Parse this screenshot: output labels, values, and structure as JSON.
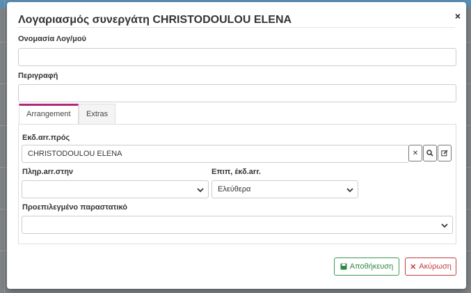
{
  "modal": {
    "title": "Λογαριασμός συνεργάτη CHRISTODOULOU ELENA",
    "close_symbol": "×"
  },
  "fields": {
    "account_name": {
      "label": "Ονομασία Λογ/μού",
      "value": ""
    },
    "description": {
      "label": "Περιγραφή",
      "value": ""
    }
  },
  "tabs": [
    {
      "label": "Arrangement",
      "active": true
    },
    {
      "label": "Extras",
      "active": false
    }
  ],
  "arrangement": {
    "issued_to": {
      "label": "Εκδ.αrr.πρός",
      "value": "CHRISTODOULOU ELENA"
    },
    "pay_to": {
      "label": "Πληρ.arr.στην",
      "value": ""
    },
    "issue_option": {
      "label": "Επιπ, έκδ.arr.",
      "value": "Ελεύθερα"
    },
    "default_doc": {
      "label": "Προεπιλεγμένο παραστατικό",
      "value": ""
    }
  },
  "buttons": {
    "save": {
      "label": "Αποθήκευση",
      "color": "#2e8a3f"
    },
    "cancel": {
      "label": "Ακύρωση",
      "color": "#c43b3b"
    }
  },
  "colors": {
    "active_tab_accent": "#b0267a"
  }
}
